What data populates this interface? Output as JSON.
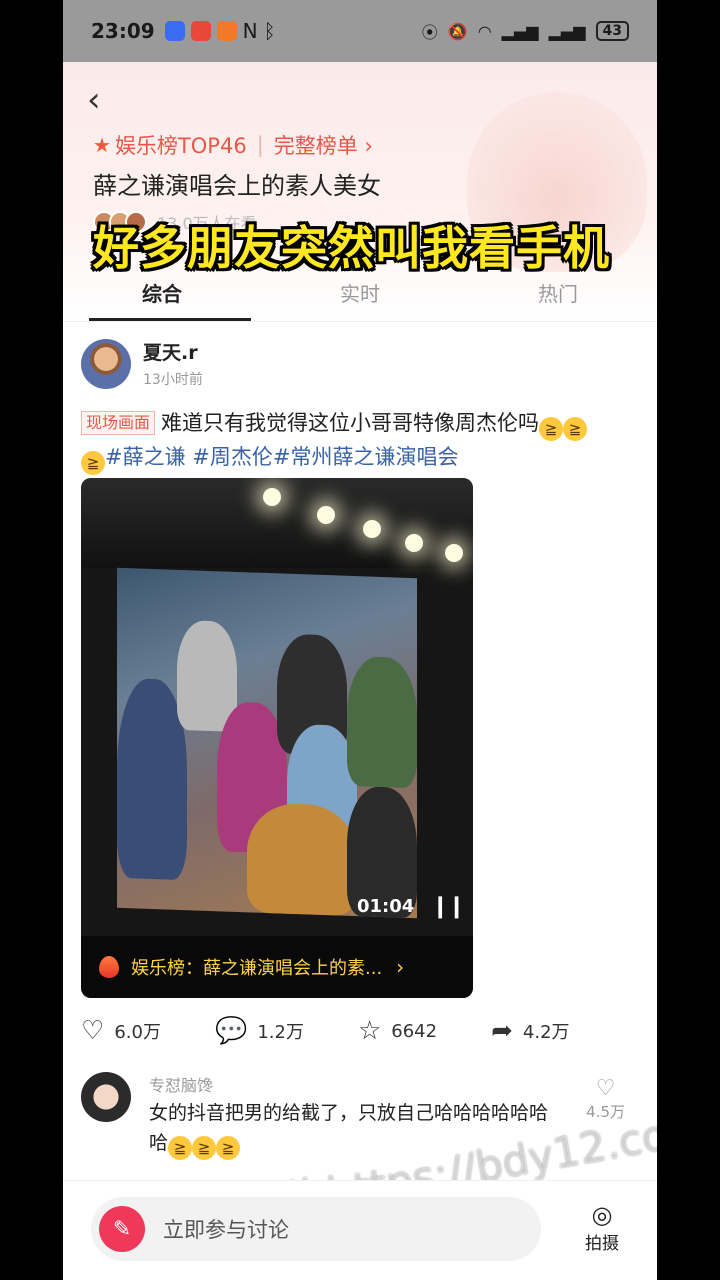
{
  "status_bar": {
    "time": "23:09",
    "battery": "43"
  },
  "header": {
    "back_icon": "chevron-left-icon",
    "rank_label": "娱乐榜TOP46",
    "full_list_label": "完整榜单",
    "topic_title": "薛之谦演唱会上的素人美女",
    "viewers_text": "13.0万人在看",
    "overlay_caption": "好多朋友突然叫我看手机"
  },
  "tabs": [
    "综合",
    "实时",
    "热门"
  ],
  "post": {
    "author": "夏天.r",
    "time": "13小时前",
    "badge": "现场画面",
    "text": "难道只有我觉得这位小哥哥特像周杰伦吗",
    "hashtags": "#薛之谦 #周杰伦#常州薛之谦演唱会",
    "video": {
      "duration": "01:04",
      "bar_text": "娱乐榜：薛之谦演唱会上的素...",
      "accent": "#ffd24a"
    },
    "actions": {
      "likes": "6.0万",
      "comments": "1.2万",
      "favorites": "6642",
      "shares": "4.2万"
    }
  },
  "comment": {
    "author": "专怼脑馋",
    "text": "女的抖音把男的给截了，只放自己哈哈哈哈哈哈哈",
    "likes": "4.5万"
  },
  "watermark": "黑料不打烊 https://bdy12.co",
  "bottom": {
    "discuss_placeholder": "立即参与讨论",
    "shoot_label": "拍摄"
  },
  "colors": {
    "brand": "#e8584a",
    "hashtag": "#3a62a8",
    "pen": "#f0385a"
  }
}
